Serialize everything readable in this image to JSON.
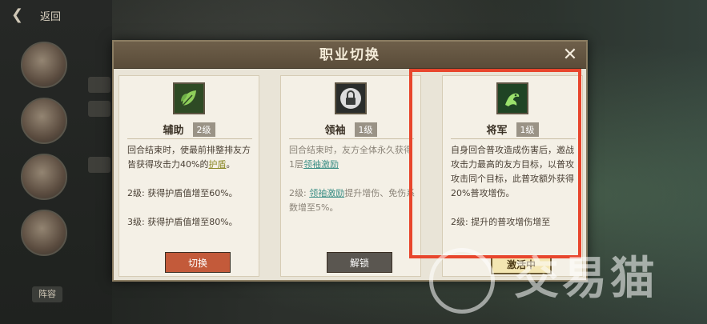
{
  "background": {
    "back_label": "返回",
    "bottom_label": "阵容"
  },
  "modal": {
    "title": "职业切换",
    "close_icon": "close-icon",
    "cards": [
      {
        "name": "辅助",
        "level": "2级",
        "icon": "leaf-icon",
        "desc_line1_a": "回合结束时，使最前排整排友方皆获得攻击力40%的",
        "desc_line1_link": "护盾",
        "desc_line1_b": "。",
        "desc_line2": "2级: 获得护盾值增至60%。",
        "desc_line3": "3级: 获得护盾值增至80%。",
        "button": "切换"
      },
      {
        "name": "领袖",
        "level": "1级",
        "icon": "lock-icon",
        "desc_line1_a": "回合结束时，友方全体永久获得1层",
        "desc_line1_link": "领袖激励",
        "desc_line1_b": "",
        "desc_line2_prefix": "2级: ",
        "desc_line2_link": "领袖激励",
        "desc_line2_rest": "提升增伤、免伤系数增至5%。",
        "button": "解锁"
      },
      {
        "name": "将军",
        "level": "1级",
        "icon": "dragon-icon",
        "desc_line1": "自身回合普攻造成伤害后，邀战攻击力最高的友方目标，以普攻攻击同个目标，此普攻额外获得20%普攻增伤。",
        "desc_line2": "2级: 提升的普攻增伤增至",
        "button": "激活中"
      }
    ]
  },
  "watermark": {
    "text": "交易猫"
  },
  "colors": {
    "accent_red": "#e8462d",
    "switch_button": "#c35a3a",
    "link_teal": "#3d8f86"
  }
}
